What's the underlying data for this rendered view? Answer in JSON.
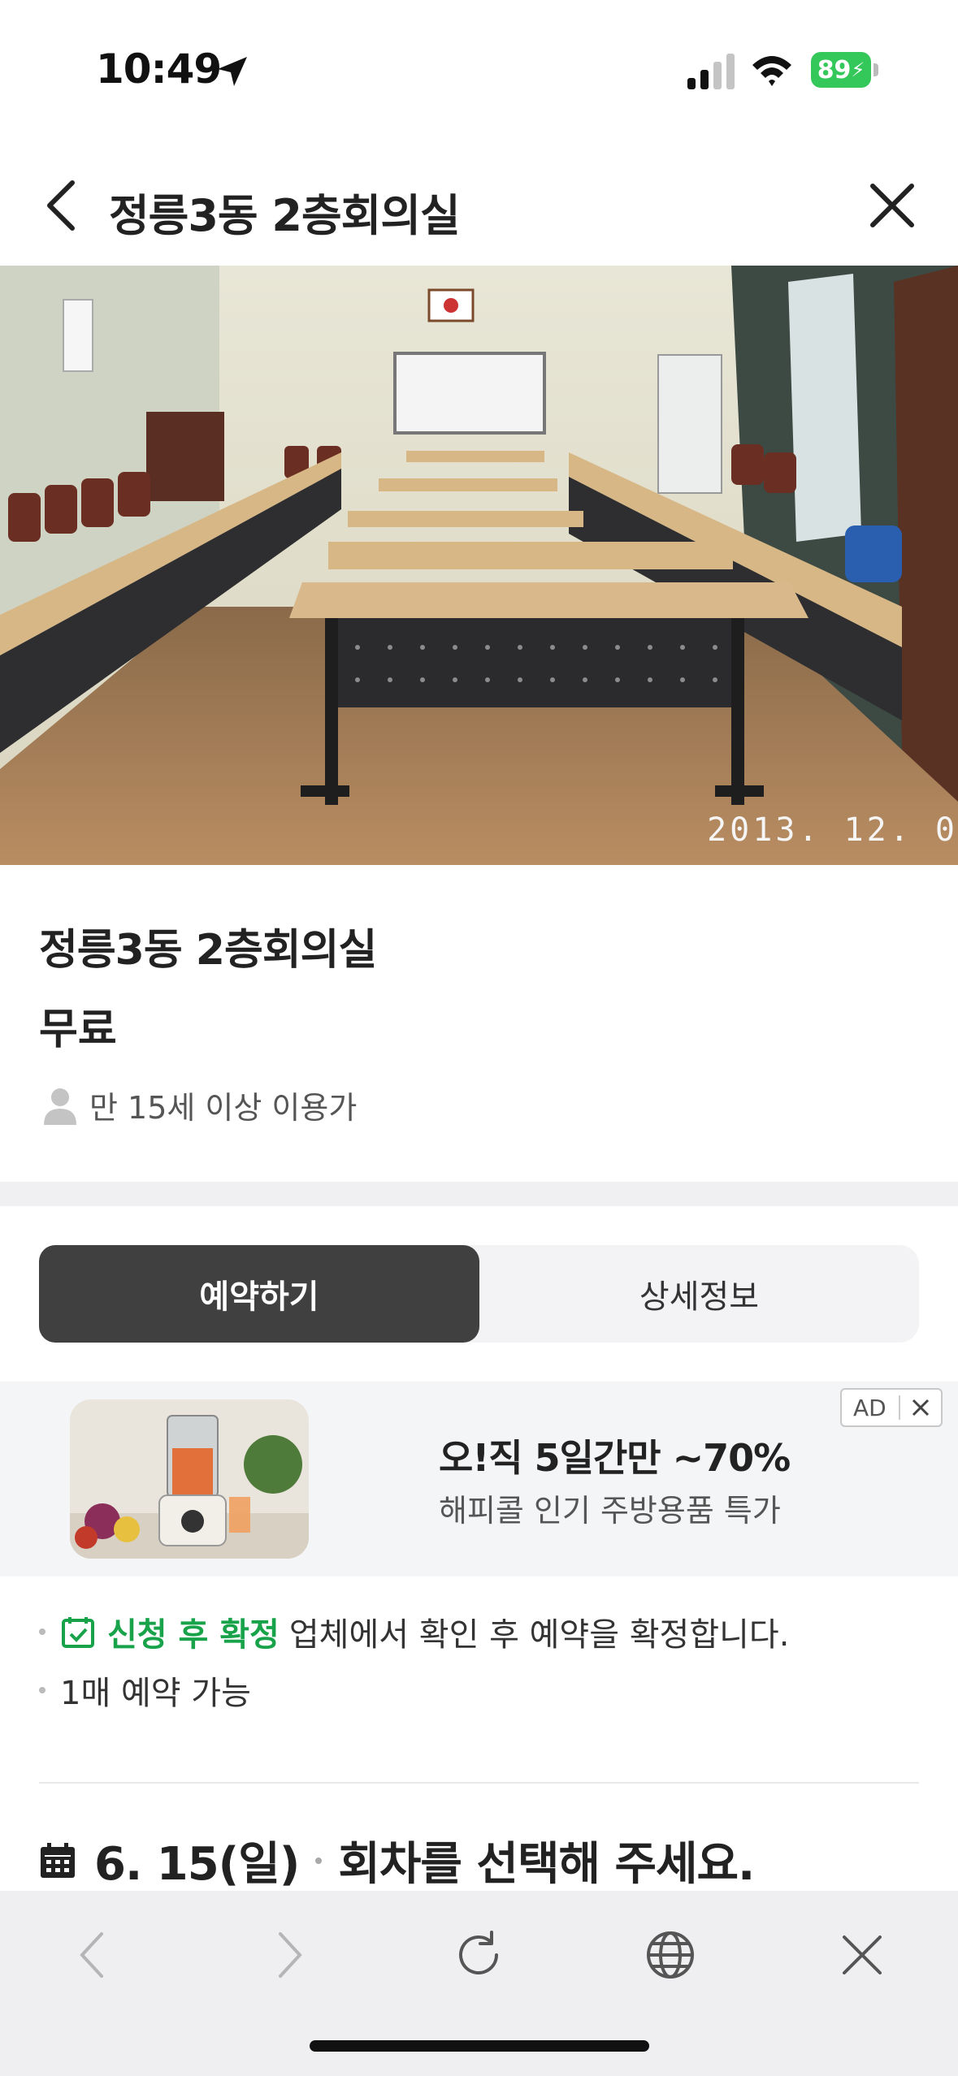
{
  "status_bar": {
    "time": "10:49",
    "battery": "89"
  },
  "header": {
    "title": "정릉3동 2층회의실"
  },
  "photo": {
    "date_stamp": "2013. 12. 0"
  },
  "info": {
    "name": "정릉3동 2층회의실",
    "price": "무료",
    "age_limit": "만 15세 이상 이용가"
  },
  "tabs": [
    {
      "label": "예약하기",
      "selected": true
    },
    {
      "label": "상세정보",
      "selected": false
    }
  ],
  "ad": {
    "badge": "AD",
    "title": "오!직 5일간만 ~70%",
    "subtitle": "해피콜 인기 주방용품 특가"
  },
  "notices": {
    "confirm_label": "신청 후 확정",
    "confirm_desc": "업체에서 확인 후 예약을 확정합니다.",
    "limit": "1매 예약 가능"
  },
  "date_row": {
    "date": "6. 15(일)",
    "prompt": "회차를 선택해 주세요."
  },
  "colors": {
    "accent_green": "#18a34a",
    "tab_selected_bg": "#404040",
    "battery_green": "#34c759"
  }
}
